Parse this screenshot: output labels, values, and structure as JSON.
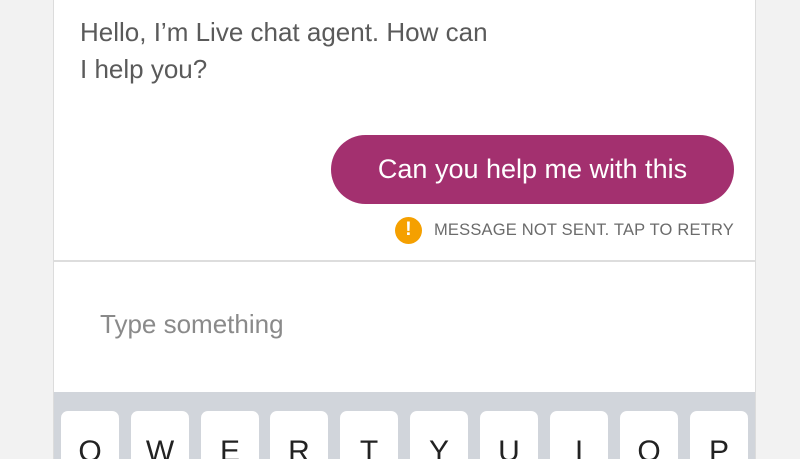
{
  "chat": {
    "agent_message_line1": "Hello, I’m Live chat agent. How can",
    "agent_message_line2": "I help you?",
    "user_message": "Can you help me with this",
    "status_icon": "!",
    "status_text": "MESSAGE NOT SENT. TAP TO RETRY"
  },
  "composer": {
    "placeholder": "Type something"
  },
  "keyboard": {
    "keys": [
      "Q",
      "W",
      "E",
      "R",
      "T",
      "Y",
      "U",
      "I",
      "O",
      "P"
    ]
  },
  "colors": {
    "bubble": "#a3306f",
    "warning": "#f5a000",
    "keyboard_bg": "#d1d5db"
  }
}
